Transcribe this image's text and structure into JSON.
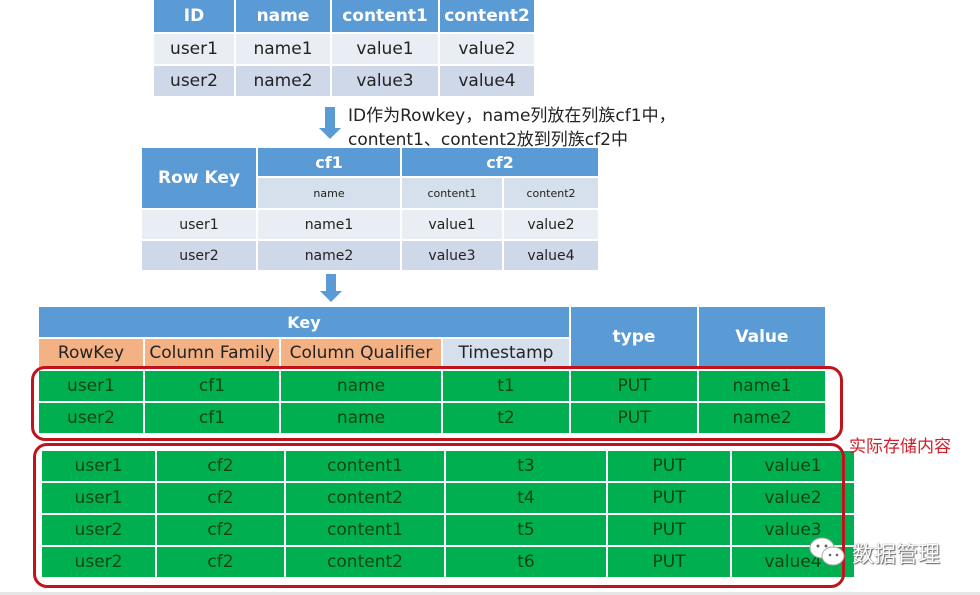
{
  "source_table": {
    "headers": [
      "ID",
      "name",
      "content1",
      "content2"
    ],
    "rows": [
      [
        "user1",
        "name1",
        "value1",
        "value2"
      ],
      [
        "user2",
        "name2",
        "value3",
        "value4"
      ]
    ]
  },
  "annotation": {
    "line1": "ID作为Rowkey，name列放在列族cf1中，",
    "line2": "content1、content2放到列族cf2中"
  },
  "hbase_table": {
    "rowkey_header": "Row Key",
    "families": [
      "cf1",
      "cf2"
    ],
    "qualifiers": [
      "name",
      "content1",
      "content2"
    ],
    "rows": [
      [
        "user1",
        "name1",
        "value1",
        "value2"
      ],
      [
        "user2",
        "name2",
        "value3",
        "value4"
      ]
    ]
  },
  "kv_table": {
    "key_header": "Key",
    "key_columns": [
      "RowKey",
      "Column Family",
      "Column Qualifier",
      "Timestamp"
    ],
    "type_header": "type",
    "value_header": "Value",
    "group1": [
      [
        "user1",
        "cf1",
        "name",
        "t1",
        "PUT",
        "name1"
      ],
      [
        "user2",
        "cf1",
        "name",
        "t2",
        "PUT",
        "name2"
      ]
    ],
    "group2": [
      [
        "user1",
        "cf2",
        "content1",
        "t3",
        "PUT",
        "value1"
      ],
      [
        "user1",
        "cf2",
        "content2",
        "t4",
        "PUT",
        "value2"
      ],
      [
        "user2",
        "cf2",
        "content1",
        "t5",
        "PUT",
        "value3"
      ],
      [
        "user2",
        "cf2",
        "content2",
        "t6",
        "PUT",
        "value4"
      ]
    ]
  },
  "storage_label": "实际存储内容",
  "watermark": "数据管理",
  "colors": {
    "header_blue": "#5b9bd5",
    "key_orange": "#f4b183",
    "stored_green": "#00b050",
    "highlight_red": "#c0141d"
  }
}
